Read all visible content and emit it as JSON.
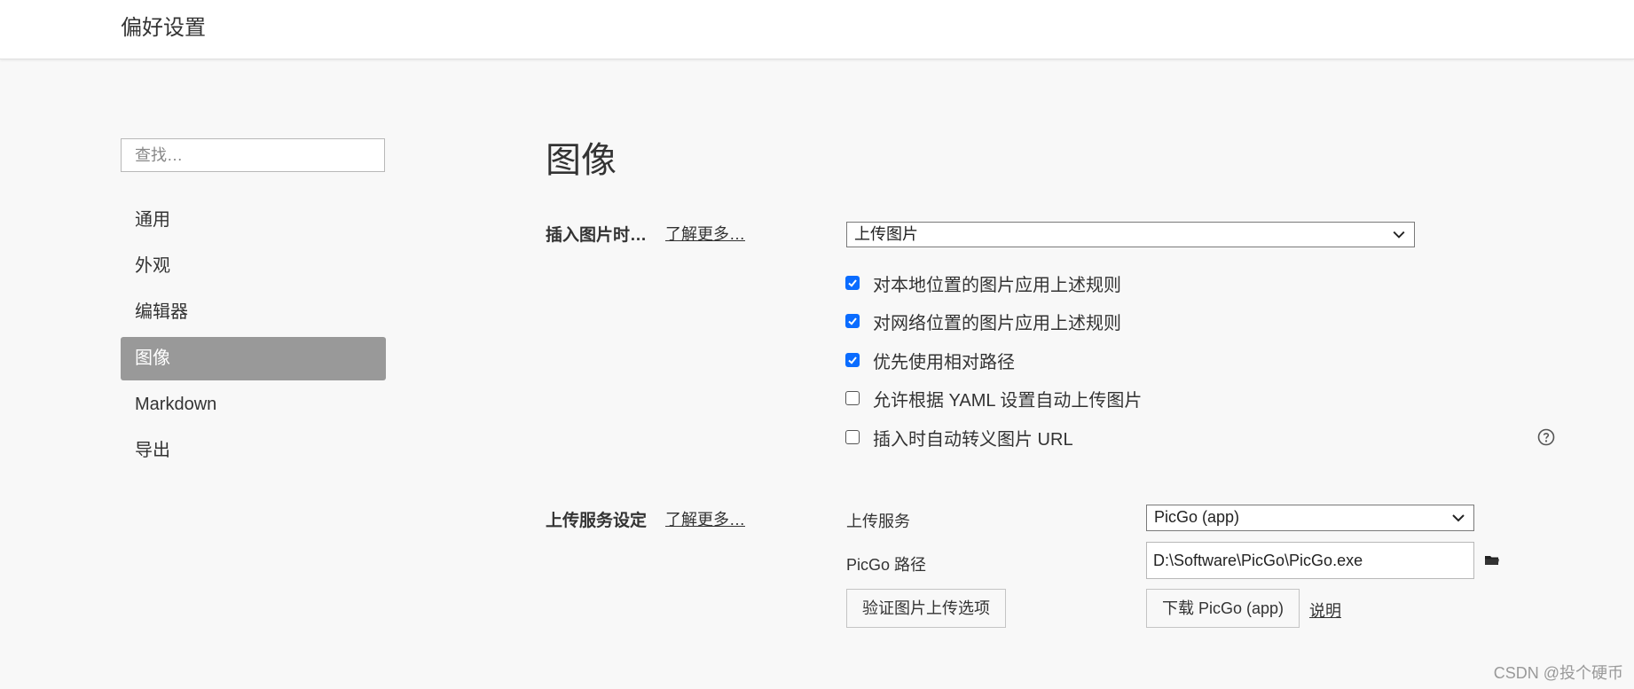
{
  "window": {
    "title": "偏好设置"
  },
  "search": {
    "placeholder": "查找…"
  },
  "nav": {
    "items": [
      {
        "label": "通用",
        "active": false
      },
      {
        "label": "外观",
        "active": false
      },
      {
        "label": "编辑器",
        "active": false
      },
      {
        "label": "图像",
        "active": true
      },
      {
        "label": "Markdown",
        "active": false
      },
      {
        "label": "导出",
        "active": false
      }
    ]
  },
  "main": {
    "title": "图像",
    "insert": {
      "label": "插入图片时…",
      "learn_more": "了解更多…",
      "selected": "上传图片",
      "options": [
        {
          "label": "对本地位置的图片应用上述规则",
          "checked": true
        },
        {
          "label": "对网络位置的图片应用上述规则",
          "checked": true
        },
        {
          "label": "优先使用相对路径",
          "checked": true
        },
        {
          "label": "允许根据 YAML 设置自动上传图片",
          "checked": false
        },
        {
          "label": "插入时自动转义图片 URL",
          "checked": false
        }
      ]
    },
    "upload": {
      "label": "上传服务设定",
      "learn_more": "了解更多…",
      "service_label": "上传服务",
      "service_value": "PicGo (app)",
      "path_label": "PicGo 路径",
      "path_value": "D:\\Software\\PicGo\\PicGo.exe",
      "verify_button": "验证图片上传选项",
      "download_button": "下载 PicGo (app)",
      "help_link": "说明"
    }
  },
  "watermark": "CSDN @投个硬币",
  "colors": {
    "accent": "#0a6cff",
    "nav_active_bg": "#999999"
  }
}
